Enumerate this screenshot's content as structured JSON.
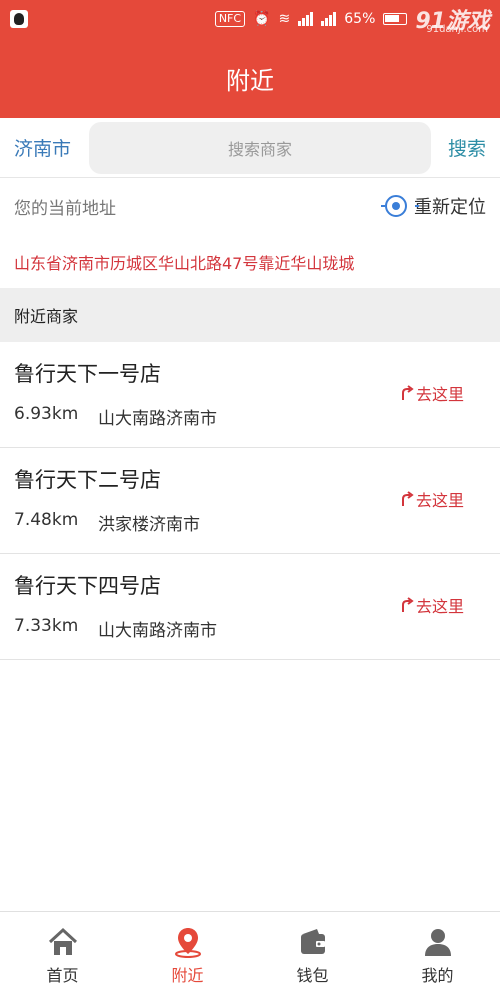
{
  "status_bar": {
    "nfc": "NFC",
    "battery_percent": "65%",
    "watermark": "91游戏",
    "watermark_sub": "91danji.com"
  },
  "header": {
    "title": "附近"
  },
  "search": {
    "city": "济南市",
    "placeholder": "搜索商家",
    "button_label": "搜索"
  },
  "location": {
    "label": "您的当前地址",
    "relocate_label": "重新定位",
    "address": "山东省济南市历城区华山北路47号靠近华山珑城"
  },
  "nearby": {
    "section_title": "附近商家",
    "goto_label": "去这里",
    "stores": [
      {
        "name": "鲁行天下一号店",
        "distance": "6.93km",
        "address": "山大南路济南市"
      },
      {
        "name": "鲁行天下二号店",
        "distance": "7.48km",
        "address": "洪家楼济南市"
      },
      {
        "name": "鲁行天下四号店",
        "distance": "7.33km",
        "address": "山大南路济南市"
      }
    ]
  },
  "tabs": [
    {
      "label": "首页",
      "icon": "home-icon",
      "active": false
    },
    {
      "label": "附近",
      "icon": "location-pin-icon",
      "active": true
    },
    {
      "label": "钱包",
      "icon": "wallet-icon",
      "active": false
    },
    {
      "label": "我的",
      "icon": "user-icon",
      "active": false
    }
  ],
  "colors": {
    "brand": "#e5493a",
    "link_blue": "#3a7ab8",
    "address_red": "#d3353c",
    "inactive_icon": "#666666"
  }
}
